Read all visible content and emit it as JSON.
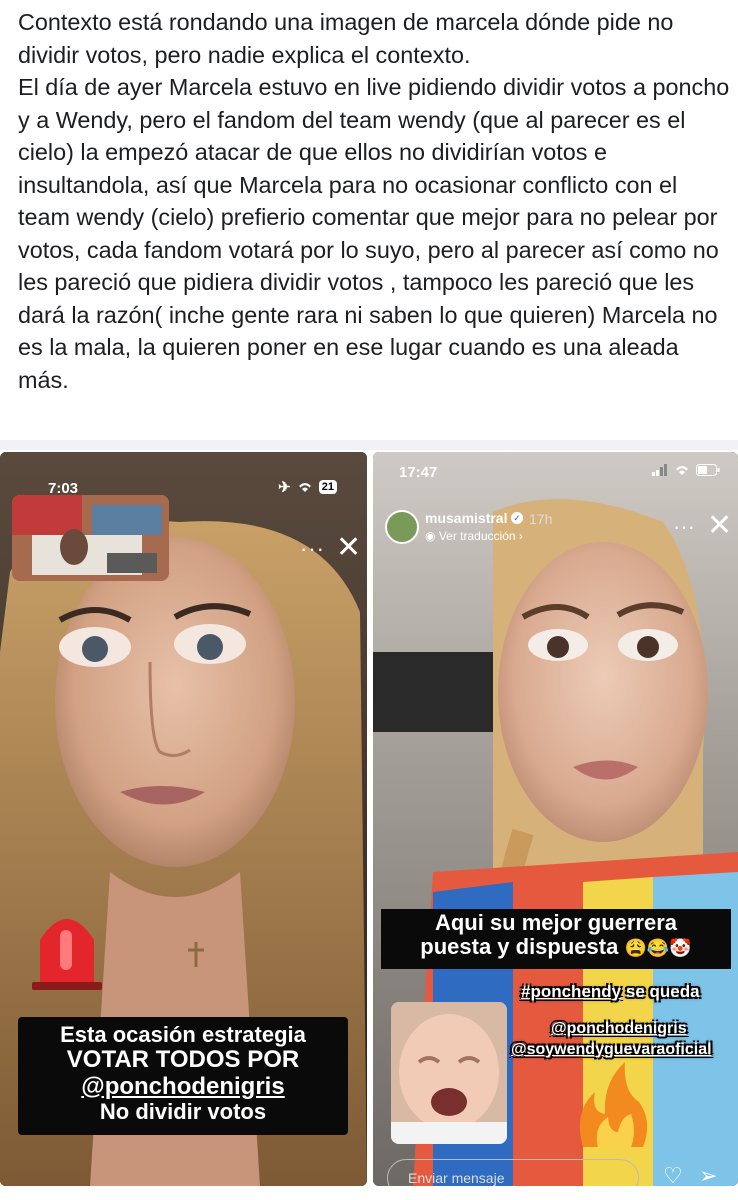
{
  "post": {
    "text": "Contexto está rondando una imagen de marcela dónde pide no dividir votos, pero nadie explica el contexto.\nEl día de ayer Marcela estuvo en live pidiendo dividir votos a poncho y a Wendy, pero el fandom del team wendy (que al parecer es el cielo) la empezó atacar de que ellos no dividirían votos e insultandola, así que Marcela para no ocasionar conflicto con el team wendy (cielo) prefierio comentar que mejor para no pelear por votos, cada fandom votará por lo suyo, pero al parecer así como no les pareció que pidiera dividir votos , tampoco les pareció que les dará la razón( inche gente rara ni saben lo que quieren) Marcela no es la mala, la quieren poner en ese lugar cuando es una aleada más."
  },
  "left_story": {
    "time": "7:03",
    "battery": "21",
    "caption_line1": "Esta ocasión estrategia",
    "caption_line2": "VOTAR TODOS POR",
    "caption_line3": "@ponchodenigris",
    "caption_line4": "No dividir votos"
  },
  "right_story": {
    "time": "17:47",
    "username": "musamistral",
    "age": "17h",
    "translate": "Ver traducción",
    "caption_line1": "Aqui su mejor guerrera",
    "caption_line2": "puesta y dispuesta",
    "emoji_line2": "😩😂🤡",
    "hashtag_line": "#ponchendy",
    "hashtag_suffix": "se queda",
    "mention1": "@ponchodenigris",
    "mention2": "@soywendyguevaraoficial",
    "message_placeholder": "Enviar mensaje"
  }
}
